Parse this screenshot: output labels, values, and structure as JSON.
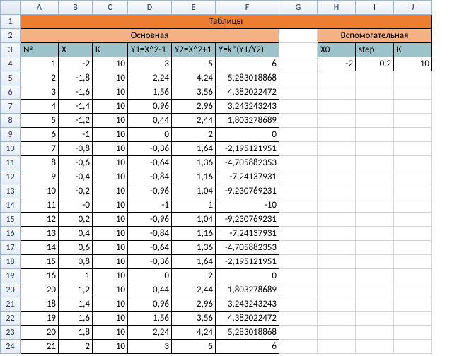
{
  "columns": [
    "",
    "A",
    "B",
    "C",
    "D",
    "E",
    "F",
    "G",
    "H",
    "I",
    "J"
  ],
  "row_numbers": [
    1,
    2,
    3,
    4,
    5,
    6,
    7,
    8,
    9,
    10,
    11,
    12,
    13,
    14,
    15,
    16,
    17,
    18,
    19,
    20,
    21,
    22,
    23,
    24
  ],
  "titles": {
    "main": "Таблицы",
    "primary": "Основная",
    "secondary": "Вспомогательная"
  },
  "labels": {
    "primary": [
      "№",
      "X",
      "K",
      "Y1=X^2-1",
      "Y2=X^2+1",
      "Y=k*(Y1/Y2)"
    ],
    "secondary": [
      "X0",
      "step",
      "K"
    ]
  },
  "secondary_values": [
    "-2",
    "0,2",
    "10"
  ],
  "primary_rows": [
    [
      "1",
      "-2",
      "10",
      "3",
      "5",
      "6"
    ],
    [
      "2",
      "-1,8",
      "10",
      "2,24",
      "4,24",
      "5,283018868"
    ],
    [
      "3",
      "-1,6",
      "10",
      "1,56",
      "3,56",
      "4,382022472"
    ],
    [
      "4",
      "-1,4",
      "10",
      "0,96",
      "2,96",
      "3,243243243"
    ],
    [
      "5",
      "-1,2",
      "10",
      "0,44",
      "2,44",
      "1,803278689"
    ],
    [
      "6",
      "-1",
      "10",
      "0",
      "2",
      "0"
    ],
    [
      "7",
      "-0,8",
      "10",
      "-0,36",
      "1,64",
      "-2,195121951"
    ],
    [
      "8",
      "-0,6",
      "10",
      "-0,64",
      "1,36",
      "-4,705882353"
    ],
    [
      "9",
      "-0,4",
      "10",
      "-0,84",
      "1,16",
      "-7,24137931"
    ],
    [
      "10",
      "-0,2",
      "10",
      "-0,96",
      "1,04",
      "-9,230769231"
    ],
    [
      "11",
      "-0",
      "10",
      "-1",
      "1",
      "-10"
    ],
    [
      "12",
      "0,2",
      "10",
      "-0,96",
      "1,04",
      "-9,230769231"
    ],
    [
      "13",
      "0,4",
      "10",
      "-0,84",
      "1,16",
      "-7,24137931"
    ],
    [
      "14",
      "0,6",
      "10",
      "-0,64",
      "1,36",
      "-4,705882353"
    ],
    [
      "15",
      "0,8",
      "10",
      "-0,36",
      "1,64",
      "-2,195121951"
    ],
    [
      "16",
      "1",
      "10",
      "0",
      "2",
      "0"
    ],
    [
      "20",
      "1,2",
      "10",
      "0,44",
      "2,44",
      "1,803278689"
    ],
    [
      "18",
      "1,4",
      "10",
      "0,96",
      "2,96",
      "3,243243243"
    ],
    [
      "19",
      "1,6",
      "10",
      "1,56",
      "3,56",
      "4,382022472"
    ],
    [
      "20",
      "1,8",
      "10",
      "2,24",
      "4,24",
      "5,283018868"
    ],
    [
      "21",
      "2",
      "10",
      "3",
      "5",
      "6"
    ]
  ]
}
